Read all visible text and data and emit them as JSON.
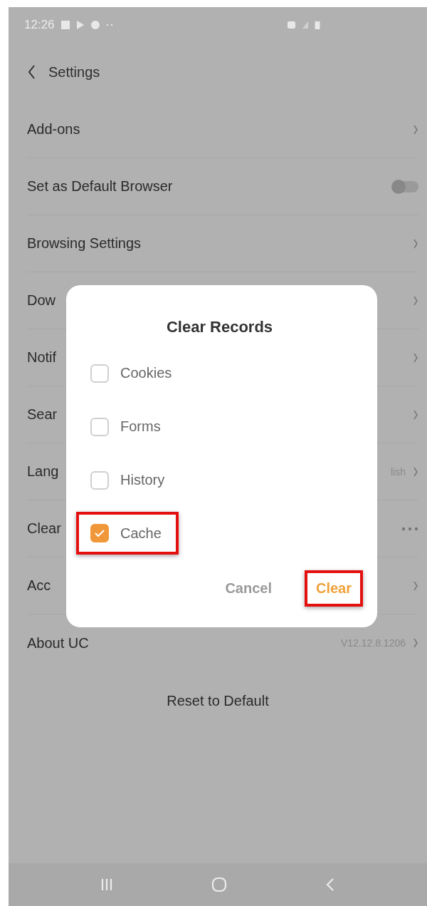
{
  "status_bar": {
    "time": "12:26"
  },
  "header": {
    "title": "Settings"
  },
  "settings": [
    {
      "label": "Add-ons",
      "kind": "link"
    },
    {
      "label": "Set as Default Browser",
      "kind": "toggle",
      "on": false
    },
    {
      "label": "Browsing Settings",
      "kind": "link"
    },
    {
      "label": "Dow",
      "kind": "link"
    },
    {
      "label": "Notif",
      "kind": "link"
    },
    {
      "label": "Sear",
      "kind": "link"
    },
    {
      "label": "Lang",
      "kind": "link",
      "value": "lish"
    },
    {
      "label": "Clear",
      "kind": "more"
    },
    {
      "label": "Acc",
      "kind": "link"
    },
    {
      "label": "About UC",
      "kind": "link",
      "value": "V12.12.8.1206"
    }
  ],
  "reset_button": "Reset to Default",
  "dialog": {
    "title": "Clear Records",
    "options": [
      {
        "label": "Cookies",
        "checked": false,
        "highlighted": false
      },
      {
        "label": "Forms",
        "checked": false,
        "highlighted": false
      },
      {
        "label": "History",
        "checked": false,
        "highlighted": false
      },
      {
        "label": "Cache",
        "checked": true,
        "highlighted": true
      }
    ],
    "buttons": [
      {
        "label": "Cancel",
        "kind": "secondary",
        "highlighted": false
      },
      {
        "label": "Clear",
        "kind": "primary",
        "highlighted": true
      }
    ]
  }
}
